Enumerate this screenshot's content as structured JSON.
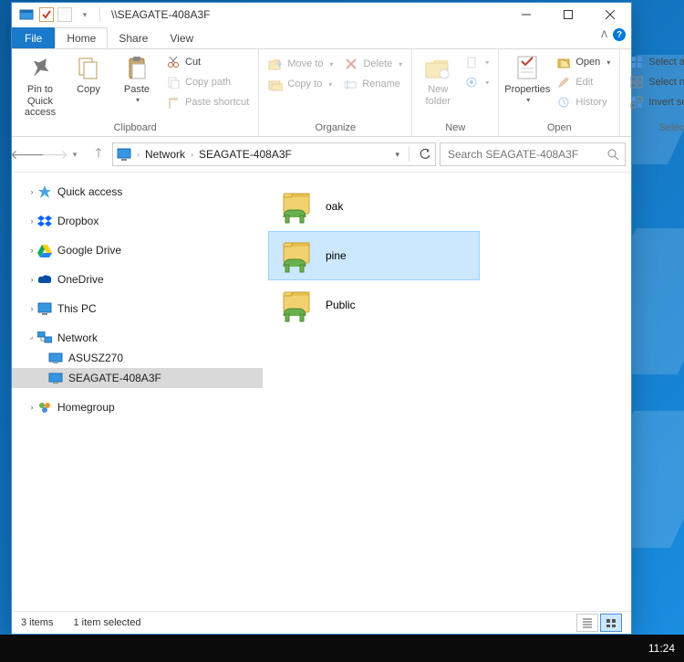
{
  "window": {
    "title": "\\\\SEAGATE-408A3F"
  },
  "qat": {
    "checked": true
  },
  "controls": {
    "minimize": "—",
    "maximize": "▢",
    "close": "✕"
  },
  "menu": {
    "file": "File"
  },
  "tabs": {
    "home": "Home",
    "share": "Share",
    "view": "View"
  },
  "ribbon": {
    "clipboard": {
      "label": "Clipboard",
      "pin": "Pin to Quick access",
      "copy": "Copy",
      "paste": "Paste",
      "cut": "Cut",
      "copypath": "Copy path",
      "pasteshortcut": "Paste shortcut"
    },
    "organize": {
      "label": "Organize",
      "moveto": "Move to",
      "copyto": "Copy to",
      "delete": "Delete",
      "rename": "Rename"
    },
    "new": {
      "label": "New",
      "newfolder": "New folder",
      "newitem": "",
      "easyaccess": ""
    },
    "open": {
      "label": "Open",
      "properties": "Properties",
      "open": "Open",
      "edit": "Edit",
      "history": "History"
    },
    "select": {
      "label": "Select",
      "selectall": "Select all",
      "selectnone": "Select none",
      "invert": "Invert selection"
    }
  },
  "breadcrumb": {
    "network": "Network",
    "host": "SEAGATE-408A3F"
  },
  "address_dropdown": "▾",
  "refresh": "⟳",
  "search": {
    "placeholder": "Search SEAGATE-408A3F"
  },
  "sidebar": {
    "quick": "Quick access",
    "dropbox": "Dropbox",
    "gdrive": "Google Drive",
    "onedrive": "OneDrive",
    "thispc": "This PC",
    "network": "Network",
    "net_children": [
      "ASUSZ270",
      "SEAGATE-408A3F"
    ],
    "homegroup": "Homegroup"
  },
  "shares": [
    {
      "name": "oak",
      "selected": false
    },
    {
      "name": "pine",
      "selected": true
    },
    {
      "name": "Public",
      "selected": false
    }
  ],
  "status": {
    "count": "3 items",
    "selection": "1 item selected"
  },
  "taskbar": {
    "clock": "11:24"
  }
}
